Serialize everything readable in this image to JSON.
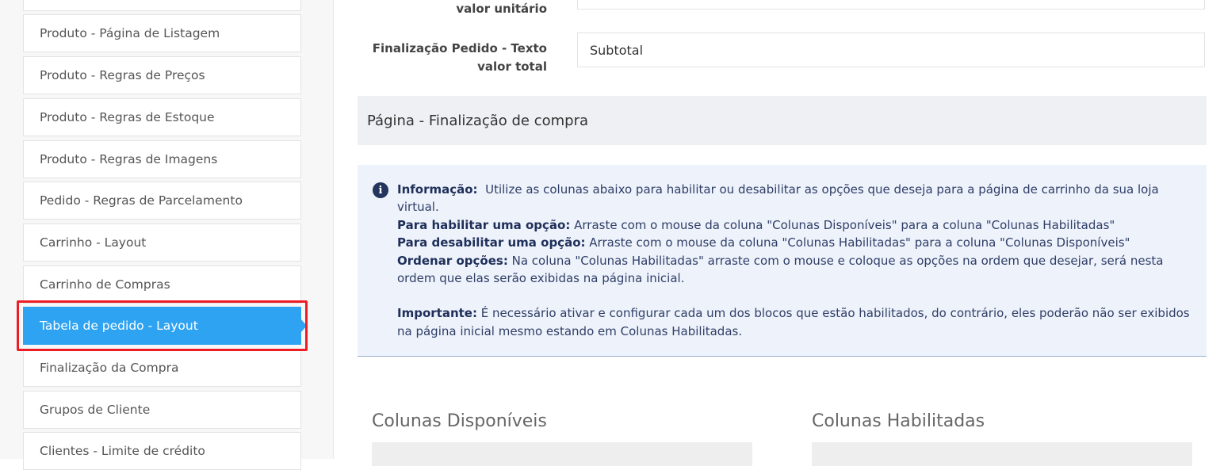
{
  "sidebar": {
    "items": [
      {
        "label": "Produto - Página de Listagem"
      },
      {
        "label": "Produto - Regras de Preços"
      },
      {
        "label": "Produto - Regras de Estoque"
      },
      {
        "label": "Produto - Regras de Imagens"
      },
      {
        "label": "Pedido - Regras de Parcelamento"
      },
      {
        "label": "Carrinho - Layout"
      },
      {
        "label": "Carrinho de Compras"
      },
      {
        "label": "Tabela de pedido - Layout",
        "active": true
      },
      {
        "label": "Finalização da Compra"
      },
      {
        "label": "Grupos de Cliente"
      },
      {
        "label": "Clientes - Limite de crédito"
      }
    ]
  },
  "form": {
    "unit_value_label_tail": "valor unitário",
    "unit_value_input": "",
    "total_label_line1": "Finalização Pedido - Texto",
    "total_label_line2": "valor total",
    "total_input": "Subtotal"
  },
  "section": {
    "title": "Página - Finalização de compra"
  },
  "info": {
    "icon": "info-icon",
    "intro_label": "Informação:",
    "intro_text": "Utilize as colunas abaixo para habilitar ou desabilitar as opções que deseja para a página de carrinho da sua loja virtual.",
    "enable_label": "Para habilitar uma opção:",
    "enable_text": "Arraste com o mouse da coluna \"Colunas Disponíveis\" para a coluna \"Colunas Habilitadas\"",
    "disable_label": "Para desabilitar uma opção:",
    "disable_text": "Arraste com o mouse da coluna \"Colunas Habilitadas\" para a coluna \"Colunas Disponíveis\"",
    "order_label": "Ordenar opções:",
    "order_text": "Na coluna \"Colunas Habilitadas\" arraste com o mouse e coloque as opções na ordem que desejar, será nesta ordem que elas serão exibidas na página inicial.",
    "important_label": "Importante:",
    "important_text": "É necessário ativar e configurar cada um dos blocos que estão habilitados, do contrário, eles poderão não ser exibidos na página inicial mesmo estando em Colunas Habilitadas."
  },
  "columns": {
    "available_title": "Colunas Disponíveis",
    "enabled_title": "Colunas Habilitadas"
  },
  "colors": {
    "active": "#2ea3f2",
    "highlight": "#ee1c25",
    "info_bg": "#edf2fb",
    "info_text": "#2f3e66"
  }
}
